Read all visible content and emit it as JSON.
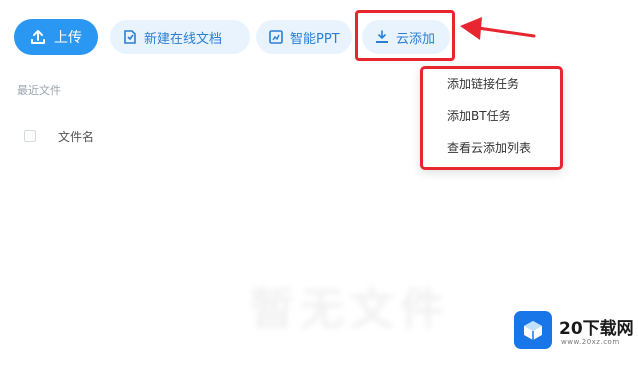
{
  "toolbar": {
    "upload_label": "上传",
    "new_doc_label": "新建在线文档",
    "smart_ppt_label": "智能PPT",
    "cloud_add_label": "云添加"
  },
  "dropdown": {
    "items": [
      "添加链接任务",
      "添加BT任务",
      "查看云添加列表"
    ]
  },
  "content": {
    "recent_label": "最近文件",
    "column_name_label": "文件名",
    "background_watermark": "暂无文件"
  },
  "watermark": {
    "site_name": "20下载网",
    "site_url": "www.20xz.com"
  },
  "colors": {
    "primary_blue": "#2a97f2",
    "pill_bg": "#e8f3fe",
    "highlight_red": "#e8262f",
    "logo_blue": "#1976e8"
  }
}
